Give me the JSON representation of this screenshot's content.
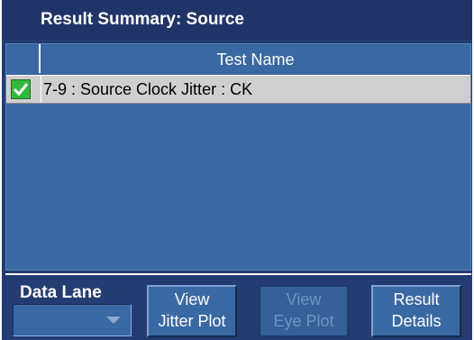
{
  "title": "Result Summary: Source",
  "table": {
    "header": "Test Name",
    "rows": [
      {
        "checked": true,
        "label": "7-9 : Source Clock Jitter : CK"
      }
    ]
  },
  "footer": {
    "data_lane_label": "Data Lane",
    "data_lane_value": "",
    "buttons": {
      "view_jitter": {
        "line1": "View",
        "line2": "Jitter Plot",
        "enabled": true
      },
      "view_eye": {
        "line1": "View",
        "line2": "Eye Plot",
        "enabled": false
      },
      "result_details": {
        "line1": "Result",
        "line2": "Details",
        "enabled": true
      }
    }
  },
  "colors": {
    "background": "#233c72",
    "panel": "#3a68a4",
    "row_selected": "#cfcfcf",
    "check_green": "#32b83a"
  }
}
